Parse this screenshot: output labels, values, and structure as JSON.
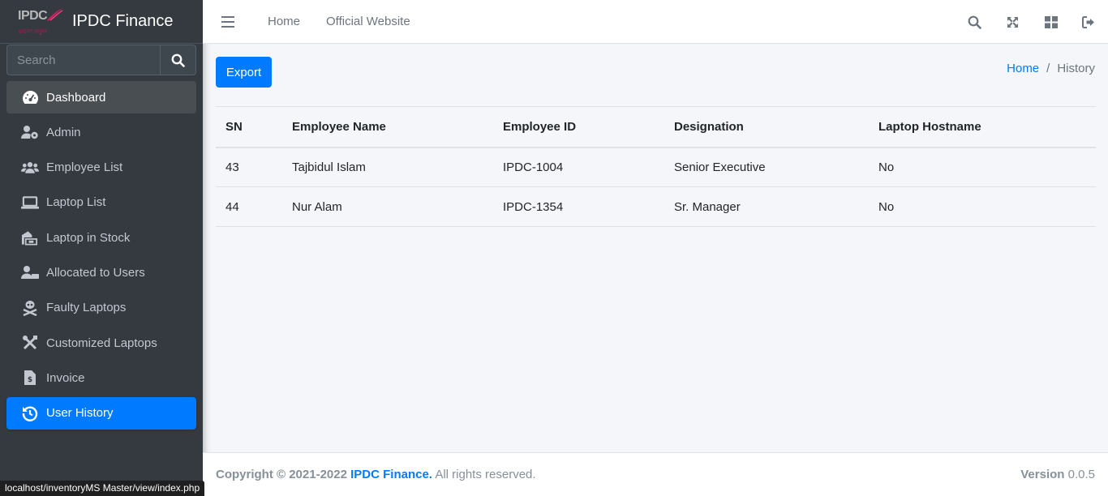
{
  "brand": {
    "name": "IPDC Finance",
    "logo_text": "IPDC",
    "logo_tagline": "ভালো থাকুন"
  },
  "search": {
    "placeholder": "Search"
  },
  "sidebar": {
    "items": [
      {
        "label": "Dashboard",
        "icon": "tachometer-icon"
      },
      {
        "label": "Admin",
        "icon": "user-cog-icon"
      },
      {
        "label": "Employee List",
        "icon": "users-icon"
      },
      {
        "label": "Laptop List",
        "icon": "laptop-icon"
      },
      {
        "label": "Laptop in Stock",
        "icon": "warehouse-icon"
      },
      {
        "label": "Allocated to Users",
        "icon": "user-check-icon"
      },
      {
        "label": "Faulty Laptops",
        "icon": "skull-crossbones-icon"
      },
      {
        "label": "Customized Laptops",
        "icon": "tools-icon"
      },
      {
        "label": "Invoice",
        "icon": "invoice-icon"
      },
      {
        "label": "User History",
        "icon": "history-icon"
      }
    ]
  },
  "topnav": {
    "home": "Home",
    "official": "Official Website"
  },
  "content": {
    "export_label": "Export",
    "breadcrumb": {
      "home": "Home",
      "sep": "/",
      "current": "History"
    }
  },
  "table": {
    "headers": [
      "SN",
      "Employee Name",
      "Employee ID",
      "Designation",
      "Laptop Hostname"
    ],
    "rows": [
      [
        "43",
        "Tajbidul Islam",
        "IPDC-1004",
        "Senior Executive",
        "No"
      ],
      [
        "44",
        "Nur Alam",
        "IPDC-1354",
        "Sr. Manager",
        "No"
      ]
    ]
  },
  "footer": {
    "copyright": "Copyright © 2021-2022",
    "brand": "IPDC Finance.",
    "rights": "All rights reserved.",
    "version_label": "Version",
    "version": "0.0.5"
  },
  "statusbar": "localhost/inventoryMS Master/view/index.php",
  "colors": {
    "sidebar": "#343a40",
    "accent": "#007bff",
    "content_bg": "#f4f6f9"
  }
}
